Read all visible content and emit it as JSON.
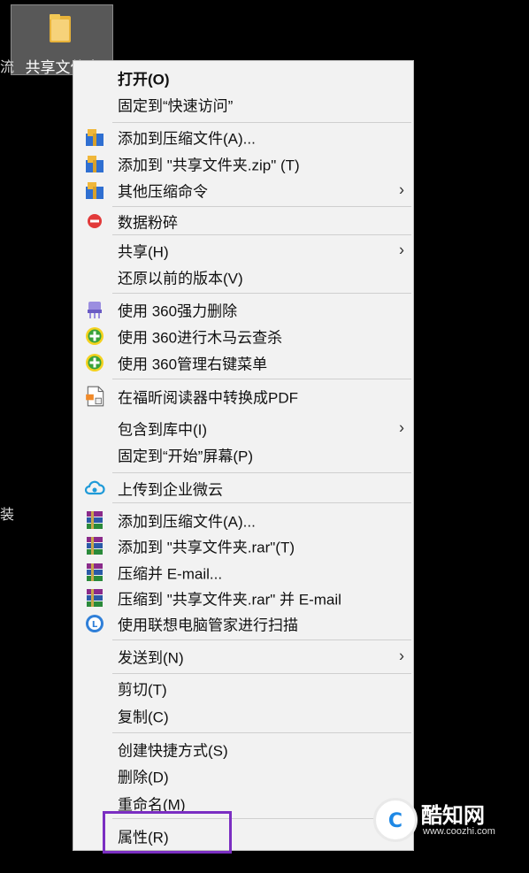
{
  "desktop": {
    "folder_label": "共享文件夹",
    "edge_left_top": "流",
    "edge_left_mid": "装"
  },
  "menu": {
    "items": [
      {
        "label": "打开(O)",
        "icon": "none"
      },
      {
        "label": "固定到“快速访问”",
        "icon": "none"
      },
      {
        "label": "添加到压缩文件(A)...",
        "icon": "archive-blue-icon"
      },
      {
        "label": "添加到 \"共享文件夹.zip\" (T)",
        "icon": "archive-blue-icon"
      },
      {
        "label": "其他压缩命令",
        "icon": "archive-blue-icon",
        "submenu": "›"
      },
      {
        "label": "数据粉碎",
        "icon": "red-minus-circle-icon"
      },
      {
        "label": "共享(H)",
        "icon": "none",
        "submenu": "›"
      },
      {
        "label": "还原以前的版本(V)",
        "icon": "none"
      },
      {
        "label": "使用 360强力删除",
        "icon": "purple-shredder-icon"
      },
      {
        "label": "使用 360进行木马云查杀",
        "icon": "360-plus-icon"
      },
      {
        "label": "使用 360管理右键菜单",
        "icon": "360-plus-icon"
      },
      {
        "label": "在福昕阅读器中转换成PDF",
        "icon": "document-icon"
      },
      {
        "label": "包含到库中(I)",
        "icon": "none",
        "submenu": "›"
      },
      {
        "label": "固定到“开始”屏幕(P)",
        "icon": "none"
      },
      {
        "label": "上传到企业微云",
        "icon": "cloud-icon"
      },
      {
        "label": "添加到压缩文件(A)...",
        "icon": "winrar-icon"
      },
      {
        "label": "添加到 \"共享文件夹.rar\"(T)",
        "icon": "winrar-icon"
      },
      {
        "label": "压缩并 E-mail...",
        "icon": "winrar-icon"
      },
      {
        "label": "压缩到 \"共享文件夹.rar\" 并 E-mail",
        "icon": "winrar-icon"
      },
      {
        "label": "使用联想电脑管家进行扫描",
        "icon": "lenovo-scan-icon"
      },
      {
        "label": "发送到(N)",
        "icon": "none",
        "submenu": "›"
      },
      {
        "label": "剪切(T)",
        "icon": "none"
      },
      {
        "label": "复制(C)",
        "icon": "none"
      },
      {
        "label": "创建快捷方式(S)",
        "icon": "none"
      },
      {
        "label": "删除(D)",
        "icon": "none"
      },
      {
        "label": "重命名(M)",
        "icon": "none"
      },
      {
        "label": "属性(R)",
        "icon": "none"
      }
    ]
  },
  "watermark": {
    "brand": "酷知网",
    "url": "www.coozhi.com",
    "badge_letter": "C"
  },
  "colors": {
    "highlight": "#7b2ec2",
    "menu_bg": "#f2f2f2"
  }
}
